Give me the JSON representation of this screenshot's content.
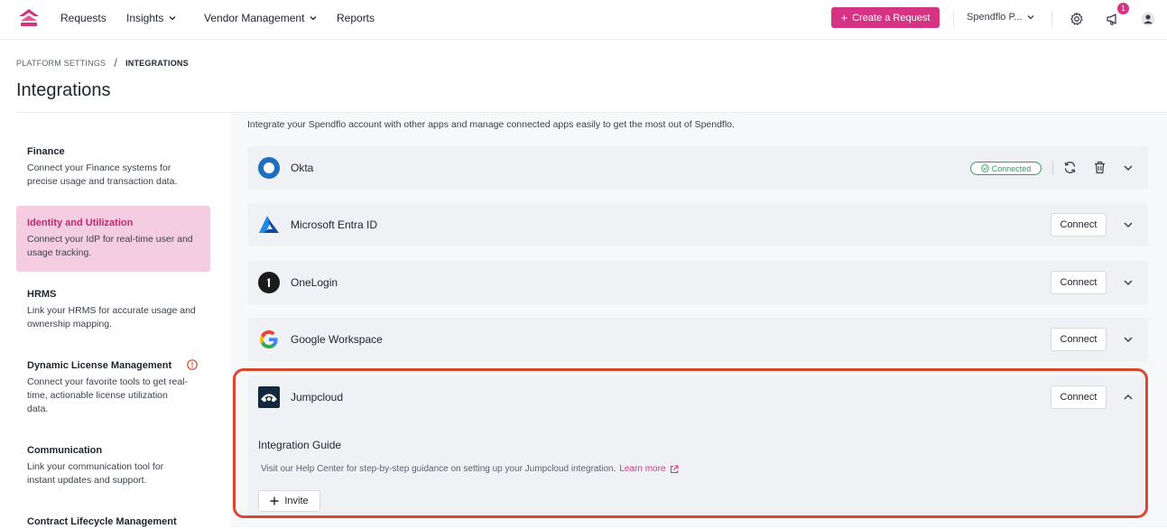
{
  "topbar": {
    "nav": [
      {
        "label": "Requests",
        "dropdown": false
      },
      {
        "label": "Insights",
        "dropdown": true
      },
      {
        "label": "Vendor Management",
        "dropdown": true
      },
      {
        "label": "Reports",
        "dropdown": false
      }
    ],
    "create_label": "Create a Request",
    "org_label": "Spendflo P...",
    "notification_count": "1",
    "brand_color": "#d63384"
  },
  "breadcrumb": {
    "parent": "PLATFORM SETTINGS",
    "separator": "/",
    "current": "INTEGRATIONS"
  },
  "page_title": "Integrations",
  "intro": "Integrate your Spendflo account with other apps and manage connected apps easily to get the most out of Spendflo.",
  "sidebar": {
    "items": [
      {
        "title": "Finance",
        "desc": "Connect your Finance systems for precise usage and transaction data.",
        "active": false
      },
      {
        "title": "Identity and Utilization",
        "desc": "Connect your IdP for real-time user and usage tracking.",
        "active": true
      },
      {
        "title": "HRMS",
        "desc": "Link your HRMS for accurate usage and ownership mapping.",
        "active": false
      },
      {
        "title": "Dynamic License Management",
        "desc": "Connect your favorite tools to get real-time, actionable license utilization data.",
        "active": false
      },
      {
        "title": "Communication",
        "desc": "Link your communication tool for instant updates and support.",
        "active": false
      },
      {
        "title": "Contract Lifecycle Management",
        "desc": "",
        "active": false
      }
    ]
  },
  "integrations": [
    {
      "name": "Okta",
      "status": "Connected",
      "icon": "okta-logo"
    },
    {
      "name": "Microsoft Entra ID",
      "action": "Connect",
      "icon": "microsoft-entra-logo"
    },
    {
      "name": "OneLogin",
      "action": "Connect",
      "icon": "onelogin-logo"
    },
    {
      "name": "Google Workspace",
      "action": "Connect",
      "icon": "google-logo"
    },
    {
      "name": "Jumpcloud",
      "action": "Connect",
      "icon": "jumpcloud-logo"
    }
  ],
  "guide": {
    "title": "Integration Guide",
    "text": "Visit our Help Center for step-by-step guidance on setting up your Jumpcloud integration.",
    "link": "Learn more",
    "invite_label": "Invite"
  }
}
